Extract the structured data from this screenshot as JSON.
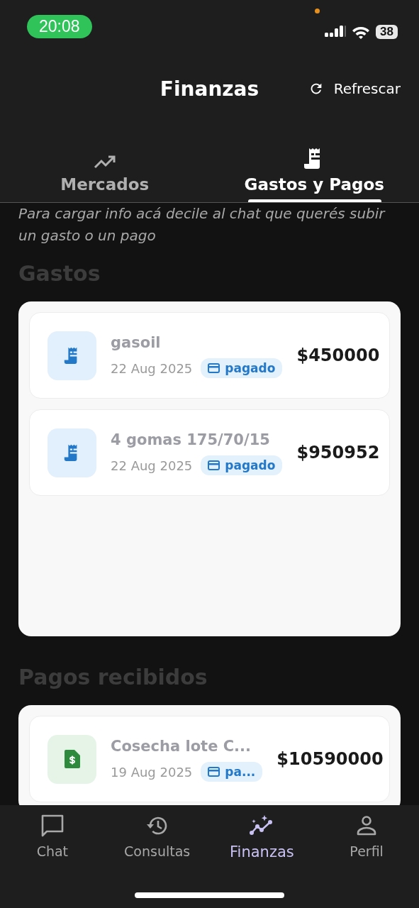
{
  "status_bar": {
    "time": "20:08",
    "battery": "38"
  },
  "header": {
    "title": "Finanzas",
    "refresh": "Refrescar"
  },
  "tabs": [
    {
      "label": "Mercados",
      "selected": false
    },
    {
      "label": "Gastos y Pagos",
      "selected": true
    }
  ],
  "hint": "Para cargar info acá decile al chat que querés subir un gasto o un pago",
  "sections": [
    {
      "title": "Gastos",
      "entries": [
        {
          "kind": "gasto",
          "title": "gasoil",
          "date": "22 Aug 2025",
          "status": "pagado",
          "amount": "$450000"
        },
        {
          "kind": "gasto",
          "title": "4 gomas 175/70/15",
          "date": "22 Aug 2025",
          "status": "pagado",
          "amount": "$950952"
        }
      ]
    },
    {
      "title": "Pagos recibidos",
      "entries": [
        {
          "kind": "pago",
          "title": "Cosecha lote C...",
          "date": "19 Aug 2025",
          "status": "pa...",
          "amount": "$10590000"
        }
      ]
    }
  ],
  "nav": [
    {
      "label": "Chat",
      "selected": false
    },
    {
      "label": "Consultas",
      "selected": false
    },
    {
      "label": "Finanzas",
      "selected": true
    },
    {
      "label": "Perfil",
      "selected": false
    }
  ]
}
